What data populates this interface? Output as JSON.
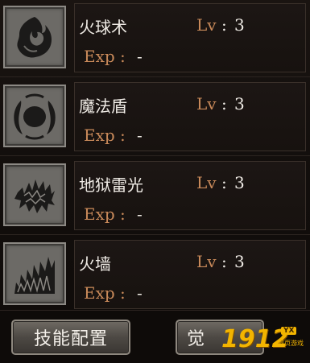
{
  "skills": [
    {
      "name": "火球术",
      "lv_label": "Lv",
      "lv_sep": " : ",
      "lv_value": "3",
      "exp_label": "Exp :",
      "exp_value": "-",
      "icon": "fireball-icon"
    },
    {
      "name": "魔法盾",
      "lv_label": "Lv",
      "lv_sep": " : ",
      "lv_value": "3",
      "exp_label": "Exp :",
      "exp_value": "-",
      "icon": "magic-shield-icon"
    },
    {
      "name": "地狱雷光",
      "lv_label": "Lv",
      "lv_sep": " : ",
      "lv_value": "3",
      "exp_label": "Exp :",
      "exp_value": "-",
      "icon": "hell-thunder-icon"
    },
    {
      "name": "火墙",
      "lv_label": "Lv",
      "lv_sep": " : ",
      "lv_value": "3",
      "exp_label": "Exp :",
      "exp_value": "-",
      "icon": "fire-wall-icon"
    }
  ],
  "footer": {
    "config_label": "技能配置",
    "awaken_label": "觉"
  },
  "watermark": {
    "number": "1912",
    "badge": "YX",
    "sub": "网页游戏"
  },
  "colors": {
    "label_accent": "#c98a5a",
    "text": "#f0ece6",
    "icon_frame": "#6c6a66",
    "watermark": "#f2b400"
  }
}
